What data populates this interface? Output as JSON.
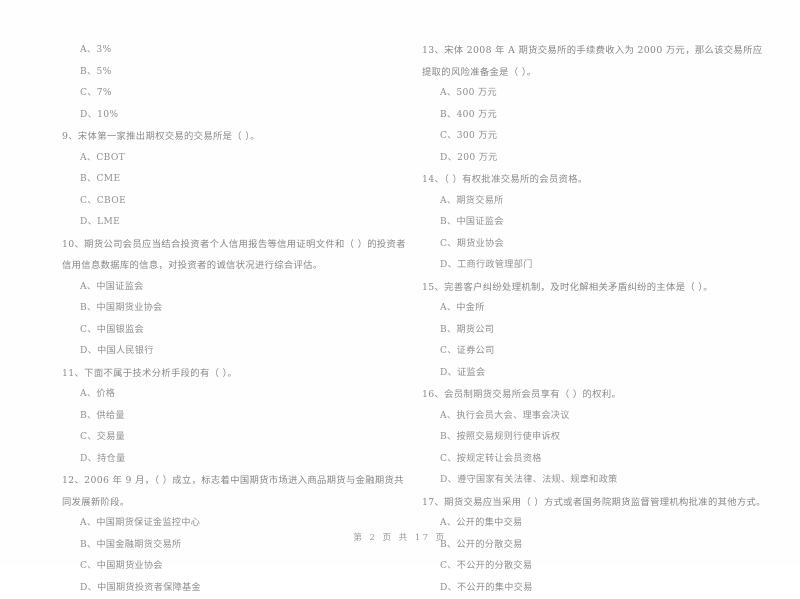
{
  "document": {
    "kind": "multiple-choice-exam-scan",
    "background_color": "#ffffff",
    "text_color": "#8c8c8c"
  },
  "footer": {
    "text": "第 2 页 共 17 页",
    "current_page": "2",
    "total_pages": "17"
  },
  "left_column": {
    "blocks": [
      {
        "id": "q8-tail",
        "stem": "",
        "options": [
          "A、3%",
          "B、5%",
          "C、7%",
          "D、10%"
        ]
      },
      {
        "id": "q9",
        "stem": "9、宋体第一家推出期权交易的交易所是（      ）。",
        "options": [
          "A、CBOT",
          "B、CME",
          "C、CBOE",
          "D、LME"
        ]
      },
      {
        "id": "q10",
        "stem": "10、期货公司会员应当结合投资者个人信用报告等信用证明文件和（      ）的投资者信用信息数据库的信息，对投资者的诚信状况进行综合评估。",
        "options": [
          "A、中国证监会",
          "B、中国期货业协会",
          "C、中国银监会",
          "D、中国人民银行"
        ]
      },
      {
        "id": "q11",
        "stem": "11、下面不属于技术分析手段的有（      ）。",
        "options": [
          "A、价格",
          "B、供给量",
          "C、交易量",
          "D、持仓量"
        ]
      },
      {
        "id": "q12",
        "stem": "12、2006 年 9 月，（      ）成立，标志着中国期货市场进入商品期货与金融期货共同发展新阶段。",
        "options": [
          "A、中国期货保证金监控中心",
          "B、中国金融期货交易所",
          "C、中国期货业协会",
          "D、中国期货投资者保障基金"
        ]
      }
    ]
  },
  "right_column": {
    "blocks": [
      {
        "id": "q13",
        "stem": "13、宋体 2008 年 A 期货交易所的手续费收入为 2000 万元，那么该交易所应提取的风险准备金是（    ）。",
        "options": [
          "A、500 万元",
          "B、400 万元",
          "C、300 万元",
          "D、200 万元"
        ]
      },
      {
        "id": "q14",
        "stem": "14、（      ）有权批准交易所的会员资格。",
        "options": [
          "A、期货交易所",
          "B、中国证监会",
          "C、期货业协会",
          "D、工商行政管理部门"
        ]
      },
      {
        "id": "q15",
        "stem": "15、完善客户纠纷处理机制，及时化解相关矛盾纠纷的主体是（      ）。",
        "options": [
          "A、中金所",
          "B、期货公司",
          "C、证券公司",
          "D、证监会"
        ]
      },
      {
        "id": "q16",
        "stem": "16、会员制期货交易所会员享有（      ）的权利。",
        "options": [
          "A、执行会员大会、理事会决议",
          "B、按照交易规则行使申诉权",
          "C、按规定转让会员资格",
          "D、遵守国家有关法律、法规、规章和政策"
        ]
      },
      {
        "id": "q17",
        "stem": "17、期货交易应当采用（      ）方式或者国务院期货监督管理机构批准的其他方式。",
        "options": [
          "A、公开的集中交易",
          "B、公开的分散交易",
          "C、不公开的分散交易",
          "D、不公开的集中交易"
        ]
      }
    ]
  }
}
